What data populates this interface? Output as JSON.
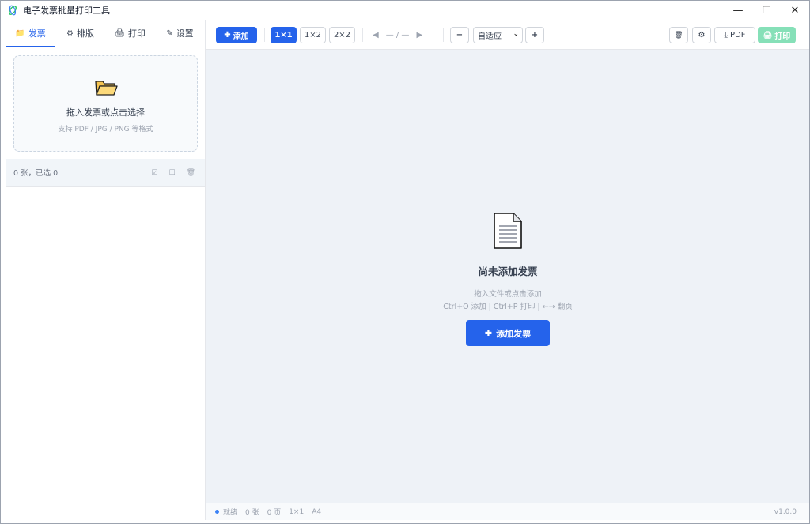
{
  "window": {
    "title": "电子发票批量打印工具",
    "minimize": "—",
    "maximize": "☐",
    "close": "✕"
  },
  "sidebar": {
    "tabs": [
      {
        "icon": "📁",
        "label": "发票"
      },
      {
        "icon": "⚙",
        "label": "排版"
      },
      {
        "icon": "🖨",
        "label": "打印"
      },
      {
        "icon": "✎",
        "label": "设置"
      }
    ],
    "dropzone": {
      "title": "拖入发票或点击选择",
      "subtitle": "支持 PDF / JPG / PNG 等格式"
    },
    "list": {
      "count_text": "0 张，已选 0",
      "actions": [
        "☑",
        "☐",
        "🗑"
      ]
    }
  },
  "toolbar": {
    "add_label": "添加",
    "layouts": [
      "1×1",
      "1×2",
      "2×2"
    ],
    "active_layout": "1×1",
    "pager": {
      "prev": "◀",
      "text": "— / —",
      "next": "▶"
    },
    "zoom_out": "−",
    "zoom_value": "自适应",
    "zoom_in": "+",
    "delete_icon": "🗑",
    "settings_icon": "⚙",
    "pdf_label": "PDF",
    "print_label": "打印"
  },
  "main": {
    "empty_title": "尚未添加发票",
    "empty_hint": "拖入文件或点击添加",
    "empty_shortcuts": "Ctrl+O 添加 | Ctrl+P 打印 | ←→ 翻页",
    "add_invoice_label": "添加发票"
  },
  "status": {
    "state": "就绪",
    "count": "0 张",
    "pages": "0 页",
    "layout": "1×1",
    "paper": "A4",
    "version": "v1.0.0"
  },
  "colors": {
    "accent": "#2563eb",
    "print_disabled": "#86e0b8",
    "main_bg": "#eef2f7"
  }
}
